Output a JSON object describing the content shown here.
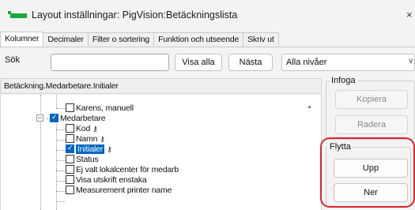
{
  "window": {
    "title": "Layout inställningar: PigVision:Betäckningslista",
    "close_label": "×",
    "accent_color": "#1fa83a"
  },
  "tabs": [
    {
      "label": "Kolumner",
      "active": true
    },
    {
      "label": "Decimaler",
      "active": false
    },
    {
      "label": "Filter o sortering",
      "active": false
    },
    {
      "label": "Funktion och utseende",
      "active": false
    },
    {
      "label": "Skriv ut",
      "active": false
    }
  ],
  "search": {
    "label": "Sök",
    "value": "",
    "show_all_label": "Visa alla",
    "next_label": "Nästa",
    "level_select": "Alla nivåer",
    "level_arrow": "∨"
  },
  "tree": {
    "path": "Betäckning.Medarbetare.Initialer",
    "scroll_up": "▲",
    "nodes": [
      {
        "label": "Karens, manuell",
        "checked": false,
        "key": false,
        "selected": false
      },
      {
        "label": "Medarbetare",
        "checked": true,
        "key": false,
        "selected": false,
        "expander": "−"
      },
      {
        "label": "Kod",
        "checked": false,
        "key": true,
        "selected": false
      },
      {
        "label": "Namn",
        "checked": false,
        "key": true,
        "selected": false
      },
      {
        "label": "Initialer",
        "checked": true,
        "key": true,
        "selected": true
      },
      {
        "label": "Status",
        "checked": false,
        "key": false,
        "selected": false
      },
      {
        "label": "Ej valt lokalcenter för medarb",
        "checked": false,
        "key": false,
        "selected": false
      },
      {
        "label": "Visa utskrift enstaka",
        "checked": false,
        "key": false,
        "selected": false
      },
      {
        "label": "Measurement printer name",
        "checked": false,
        "key": false,
        "selected": false
      }
    ],
    "key_icon": "⚷"
  },
  "infoga": {
    "legend": "Infoga",
    "copy_label": "Kopiera",
    "delete_label": "Radera"
  },
  "flytta": {
    "legend": "Flytta",
    "up_label": "Upp",
    "down_label": "Ner",
    "highlight_color": "#e0242c"
  }
}
